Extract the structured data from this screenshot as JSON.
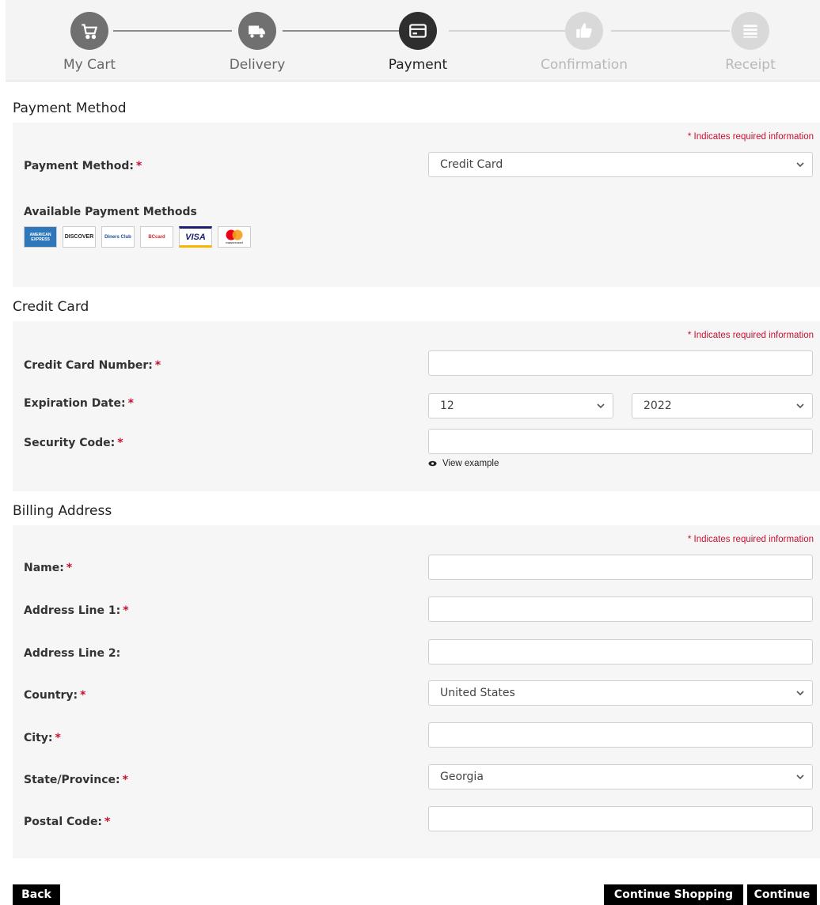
{
  "stepper": {
    "steps": [
      {
        "label": "My Cart",
        "icon": "cart-icon",
        "state": "done"
      },
      {
        "label": "Delivery",
        "icon": "truck-icon",
        "state": "done"
      },
      {
        "label": "Payment",
        "icon": "credit-card-icon",
        "state": "active"
      },
      {
        "label": "Confirmation",
        "icon": "thumbs-up-icon",
        "state": "todo"
      },
      {
        "label": "Receipt",
        "icon": "list-icon",
        "state": "todo"
      }
    ]
  },
  "required_note": "* Indicates required information",
  "payment_method": {
    "title": "Payment Method",
    "label": "Payment Method:",
    "selected": "Credit Card",
    "available_title": "Available Payment Methods",
    "logos": [
      "AMERICAN EXPRESS",
      "DISCOVER",
      "Diners Club",
      "BCcard",
      "VISA",
      "mastercard"
    ]
  },
  "credit_card": {
    "title": "Credit Card",
    "number_label": "Credit Card Number:",
    "number_value": "",
    "exp_label": "Expiration Date:",
    "exp_month": "12",
    "exp_year": "2022",
    "security_label": "Security Code:",
    "security_value": "",
    "view_example": "View example"
  },
  "billing": {
    "title": "Billing Address",
    "name_label": "Name:",
    "address1_label": "Address Line 1:",
    "address2_label": "Address Line 2:",
    "country_label": "Country:",
    "country_value": "United States",
    "city_label": "City:",
    "state_label": "State/Province:",
    "state_value": "Georgia",
    "postal_label": "Postal Code:"
  },
  "buttons": {
    "back": "Back",
    "continue_shopping": "Continue Shopping",
    "continue": "Continue"
  },
  "colors": {
    "required": "#c8102e",
    "button": "#000000",
    "panel": "#f6f6f6"
  }
}
